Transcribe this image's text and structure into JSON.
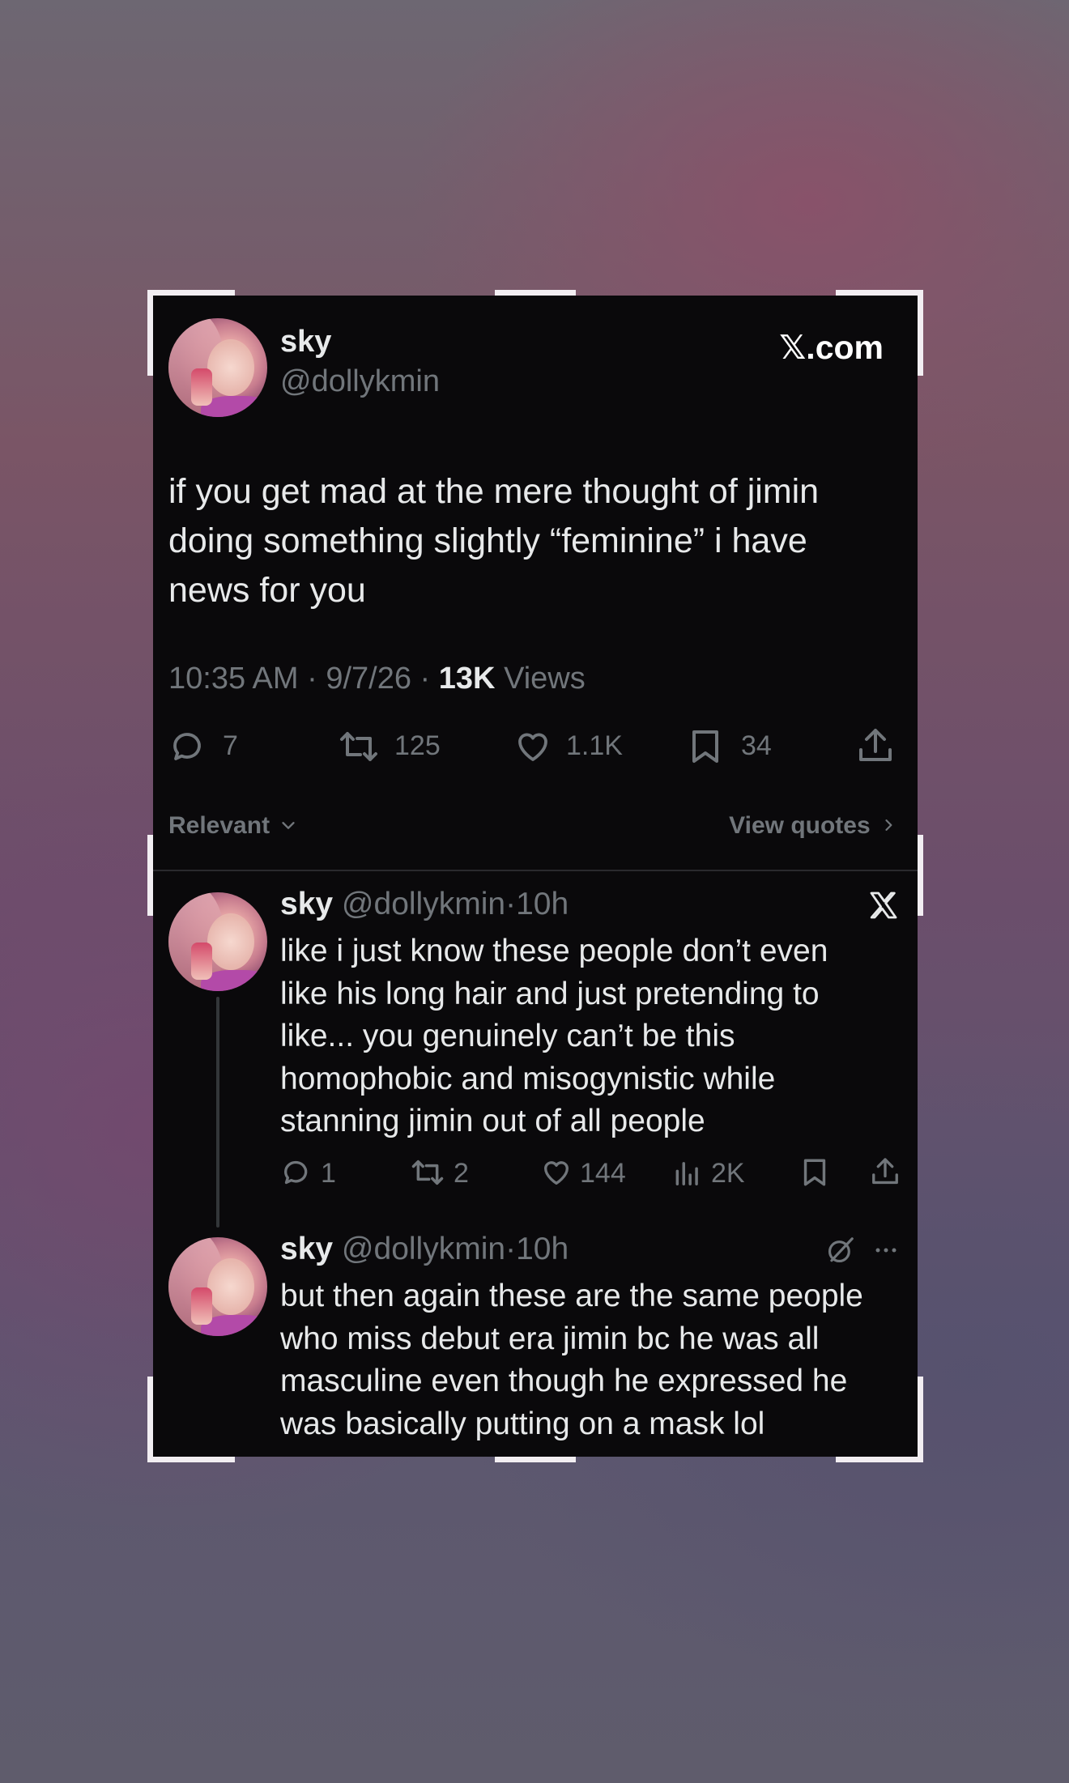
{
  "main_tweet": {
    "display_name": "sky",
    "handle": "@dollykmin",
    "brand": "𝕏.com",
    "text_lines": [
      "if you get mad at the mere thought of jimin",
      "doing something slightly “feminine” i have",
      "news for you"
    ],
    "time": "10:35 AM",
    "date": "9/7/26",
    "views_count": "13K",
    "views_label": "Views",
    "replies": "7",
    "reposts": "125",
    "likes": "1.1K",
    "bookmarks": "34"
  },
  "sort": {
    "label": "Relevant",
    "view_quotes": "View quotes"
  },
  "replies": [
    {
      "display_name": "sky",
      "handle": "@dollykmin",
      "time": "10h",
      "lines": [
        "like i just know these people don’t even",
        "like his long hair and just pretending to",
        "like... you genuinely can’t be this",
        "homophobic and misogynistic while",
        "stanning jimin out of all people"
      ],
      "replies": "1",
      "reposts": "2",
      "likes": "144",
      "views": "2K"
    },
    {
      "display_name": "sky",
      "handle": "@dollykmin",
      "time": "10h",
      "lines": [
        "but then again these are the same people",
        "who miss debut era jimin bc he was all",
        "masculine even though he expressed he",
        "was basically putting on a mask lol"
      ]
    }
  ],
  "colors": {
    "card_bg": "#0a090b",
    "text": "#e7e9ea",
    "muted": "#71767b"
  },
  "icons": [
    "reply-icon",
    "repost-icon",
    "like-icon",
    "bookmark-icon",
    "share-icon",
    "views-icon",
    "x-logo-icon",
    "grok-icon",
    "more-icon",
    "chevron-down-icon",
    "chevron-right-icon"
  ]
}
